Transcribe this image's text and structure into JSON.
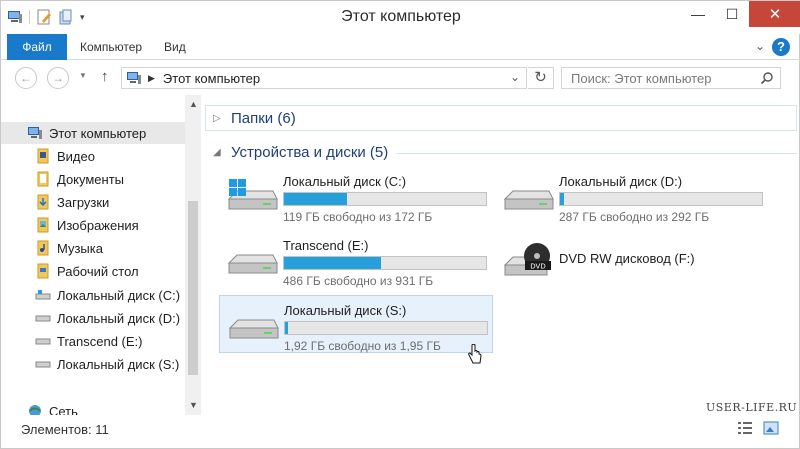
{
  "window": {
    "title": "Этот компьютер",
    "controls": {
      "minimize": "—",
      "maximize": "☐",
      "close": "✕"
    }
  },
  "ribbon": {
    "tabs": [
      {
        "label": "Файл",
        "active": true
      },
      {
        "label": "Компьютер"
      },
      {
        "label": "Вид"
      }
    ],
    "expand_icon": "chevron-down-icon",
    "help_label": "?"
  },
  "address": {
    "location": "Этот компьютер",
    "search_placeholder": "Поиск: Этот компьютер"
  },
  "sidebar": {
    "items": [
      {
        "label": "Этот компьютер",
        "icon": "computer-icon",
        "selected": true
      },
      {
        "label": "Видео",
        "icon": "video-folder-icon"
      },
      {
        "label": "Документы",
        "icon": "documents-folder-icon"
      },
      {
        "label": "Загрузки",
        "icon": "downloads-folder-icon"
      },
      {
        "label": "Изображения",
        "icon": "pictures-folder-icon"
      },
      {
        "label": "Музыка",
        "icon": "music-folder-icon"
      },
      {
        "label": "Рабочий стол",
        "icon": "desktop-folder-icon"
      },
      {
        "label": "Локальный диск (C:)",
        "icon": "system-drive-icon"
      },
      {
        "label": "Локальный диск (D:)",
        "icon": "drive-icon"
      },
      {
        "label": "Transcend (E:)",
        "icon": "drive-icon"
      },
      {
        "label": "Локальный диск (S:)",
        "icon": "drive-icon"
      },
      {
        "label": "Сеть",
        "icon": "network-icon"
      }
    ]
  },
  "groups": {
    "folders": {
      "label": "Папки (6)",
      "expanded": false
    },
    "devices": {
      "label": "Устройства и диски (5)",
      "expanded": true
    }
  },
  "drives": [
    {
      "name": "Локальный диск (C:)",
      "free": "119 ГБ свободно из 172 ГБ",
      "used_fraction": 0.31,
      "icon": "system-drive-icon"
    },
    {
      "name": "Локальный диск (D:)",
      "free": "287 ГБ свободно из 292 ГБ",
      "used_fraction": 0.02,
      "icon": "drive-icon"
    },
    {
      "name": "Transcend (E:)",
      "free": "486 ГБ свободно из 931 ГБ",
      "used_fraction": 0.48,
      "icon": "drive-icon"
    },
    {
      "name": "DVD RW дисковод (F:)",
      "icon": "dvd-drive-icon"
    },
    {
      "name": "Локальный диск (S:)",
      "free": "1,92 ГБ свободно из 1,95 ГБ",
      "used_fraction": 0.015,
      "icon": "drive-icon",
      "selected": true
    }
  ],
  "status": {
    "items_count": "Элементов: 11"
  },
  "watermark": "USER-LIFE.RU",
  "colors": {
    "accent": "#1979ca",
    "bar_fill": "#26a0da",
    "close": "#c7463a",
    "group_header": "#1e3f7a"
  }
}
